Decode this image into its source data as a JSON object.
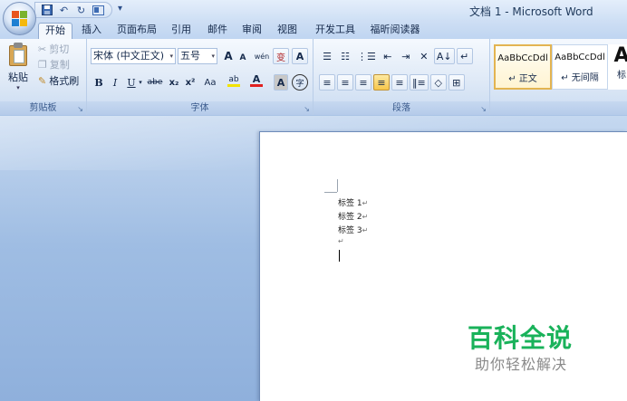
{
  "window": {
    "title": "文档 1 - Microsoft Word"
  },
  "qat": {
    "icons": [
      "save-icon",
      "undo-icon",
      "redo-icon",
      "print-preview-icon"
    ],
    "more": "▾"
  },
  "tabs": [
    {
      "label": "开始",
      "active": true
    },
    {
      "label": "插入"
    },
    {
      "label": "页面布局"
    },
    {
      "label": "引用"
    },
    {
      "label": "邮件"
    },
    {
      "label": "审阅"
    },
    {
      "label": "视图"
    },
    {
      "label": "开发工具"
    },
    {
      "label": "福昕阅读器"
    }
  ],
  "clipboard": {
    "paste": "粘贴",
    "cut": "剪切",
    "copy": "复制",
    "format_painter": "格式刷",
    "group_label": "剪贴板"
  },
  "font": {
    "name": "宋体 (中文正文)",
    "size": "五号",
    "grow": "A",
    "shrink": "A",
    "phonetic": "wén",
    "enclose_text": "变",
    "border_char": "A",
    "bold": "B",
    "italic": "I",
    "underline": "U",
    "strike": "abe",
    "subscript": "x₂",
    "superscript": "x²",
    "change_case": "Aa",
    "highlight": "ab",
    "font_color": "A",
    "shading": "A",
    "enclosed": "字",
    "group_label": "字体",
    "colors": {
      "highlight": "#f2e300",
      "font_color": "#e02020"
    }
  },
  "paragraph": {
    "group_label": "段落",
    "row1": [
      "☰",
      "☷",
      "⋮☰",
      "⇤",
      "⇥",
      "✕",
      "A↓",
      "↵"
    ],
    "row2": [
      "≡",
      "≡",
      "≡",
      "≡",
      "≡",
      "‖≡",
      "◇",
      "⊞"
    ]
  },
  "styles": [
    {
      "sample": "AaBbCcDdl",
      "name": "↵ 正文",
      "selected": true
    },
    {
      "sample": "AaBbCcDdl",
      "name": "↵ 无间隔"
    },
    {
      "sample": "A",
      "name": "标"
    }
  ],
  "document": {
    "lines": [
      "标签 1",
      "标签 2",
      "标签 3"
    ],
    "para_mark": "↵"
  },
  "watermark": {
    "title": "百科全说",
    "subtitle": "助你轻松解决"
  }
}
